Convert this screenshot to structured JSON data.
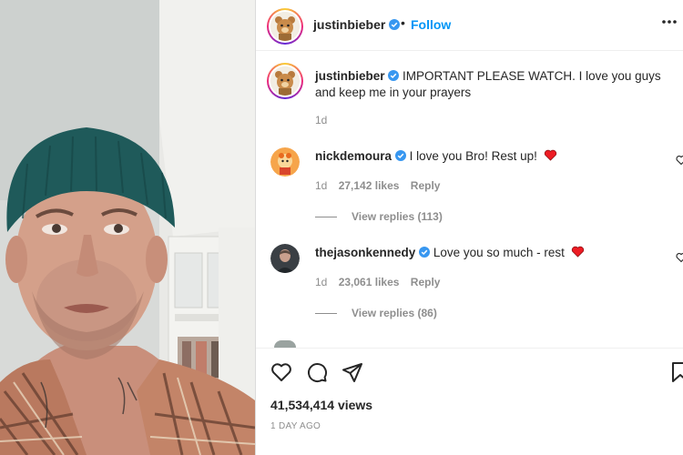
{
  "post": {
    "author": "justinbieber",
    "follow_label": "Follow",
    "separator": "•",
    "caption": "IMPORTANT PLEASE WATCH. I love you guys and keep me in your prayers",
    "caption_age": "1d",
    "views": "41,534,414 views",
    "timestamp": "1 DAY AGO"
  },
  "comments": [
    {
      "username": "nickdemoura",
      "text": "I love you Bro! Rest up!",
      "age": "1d",
      "likes": "27,142 likes",
      "reply_label": "Reply",
      "view_replies": "View replies (113)"
    },
    {
      "username": "thejasonkennedy",
      "text": "Love you so much - rest",
      "age": "1d",
      "likes": "23,061 likes",
      "reply_label": "Reply",
      "view_replies": "View replies (86)"
    }
  ],
  "icons": {
    "verified": "verified-badge-icon",
    "more": "more-options-icon",
    "like": "heart-icon",
    "comment": "comment-icon",
    "share": "share-icon",
    "save": "bookmark-icon"
  },
  "colors": {
    "link_blue": "#0095f6",
    "verified_blue": "#3897f0",
    "heart_red": "#ed1c24",
    "muted": "#8e8e8e"
  }
}
